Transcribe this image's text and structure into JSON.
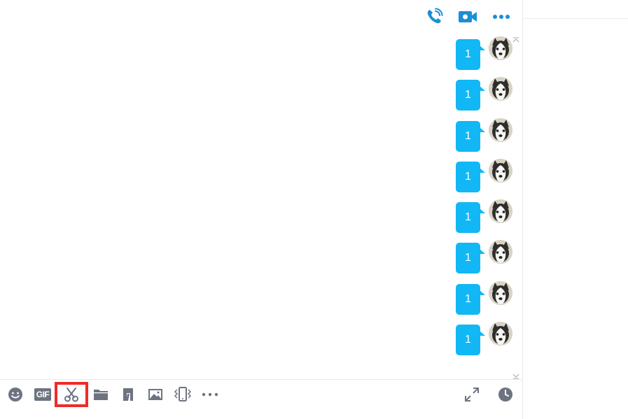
{
  "header": {
    "actions": [
      {
        "name": "voice-call",
        "icon": "phone-icon"
      },
      {
        "name": "video-call",
        "icon": "video-camera-icon"
      },
      {
        "name": "more",
        "icon": "more-horizontal-icon"
      }
    ]
  },
  "messages": [
    {
      "text": "1",
      "sender": "self"
    },
    {
      "text": "1",
      "sender": "self"
    },
    {
      "text": "1",
      "sender": "self"
    },
    {
      "text": "1",
      "sender": "self"
    },
    {
      "text": "1",
      "sender": "self"
    },
    {
      "text": "1",
      "sender": "self"
    },
    {
      "text": "1",
      "sender": "self"
    },
    {
      "text": "1",
      "sender": "self"
    }
  ],
  "toolbar": {
    "gif_label": "GIF",
    "tools": [
      "emoji-icon",
      "gif-icon",
      "screenshot-scissors-icon",
      "folder-icon",
      "document-icon",
      "image-icon",
      "shake-phone-icon",
      "more-icon"
    ],
    "highlighted_tool": "screenshot-scissors-icon",
    "right_tools": [
      "expand-icon",
      "clock-history-icon"
    ]
  },
  "colors": {
    "accent": "#1a8fd6",
    "bubble": "#12b7f5",
    "toolbar_icon": "#6d7480",
    "highlight": "#ee2b2b"
  }
}
